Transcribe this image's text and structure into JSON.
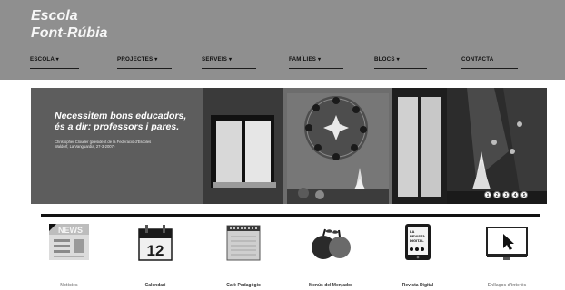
{
  "site": {
    "logo_line1": "Escola",
    "logo_line2": "Font-Rúbia"
  },
  "nav": [
    {
      "label": "ESCOLA ▾"
    },
    {
      "label": "PROJECTES ▾"
    },
    {
      "label": "SERVEIS ▾"
    },
    {
      "label": "FAMÍLIES ▾"
    },
    {
      "label": "BLOCS ▾"
    },
    {
      "label": "CONTACTA"
    }
  ],
  "hero": {
    "quote_title_line1": "Necessitem bons educadors,",
    "quote_title_line2": "és a dir: professors i pares.",
    "quote_source_line1": "Christopher Clouder (president de la Federació d'Escoles",
    "quote_source_line2": "Waldorf, La Vanguardia, 27-3-2007)",
    "slide_dots": [
      "1",
      "2",
      "3",
      "4",
      "5"
    ]
  },
  "shortcuts": [
    {
      "label": "Notícies",
      "icon": "news-icon",
      "badge": "NEWS"
    },
    {
      "label": "Calendari",
      "icon": "calendar-icon",
      "badge": "12"
    },
    {
      "label": "Cafè Pedagògic",
      "icon": "notepad-icon"
    },
    {
      "label": "Menús del Menjador",
      "icon": "apples-icon"
    },
    {
      "label": "Revista Digital",
      "icon": "tablet-icon",
      "badge": "LA REVISTA DIGITAL"
    },
    {
      "label": "Enllaços d'interès",
      "icon": "monitor-cursor-icon"
    }
  ],
  "colors": {
    "header_bg": "#8f8f8f",
    "quote_panel_bg": "#5d5d5d",
    "text_dark": "#111111"
  }
}
